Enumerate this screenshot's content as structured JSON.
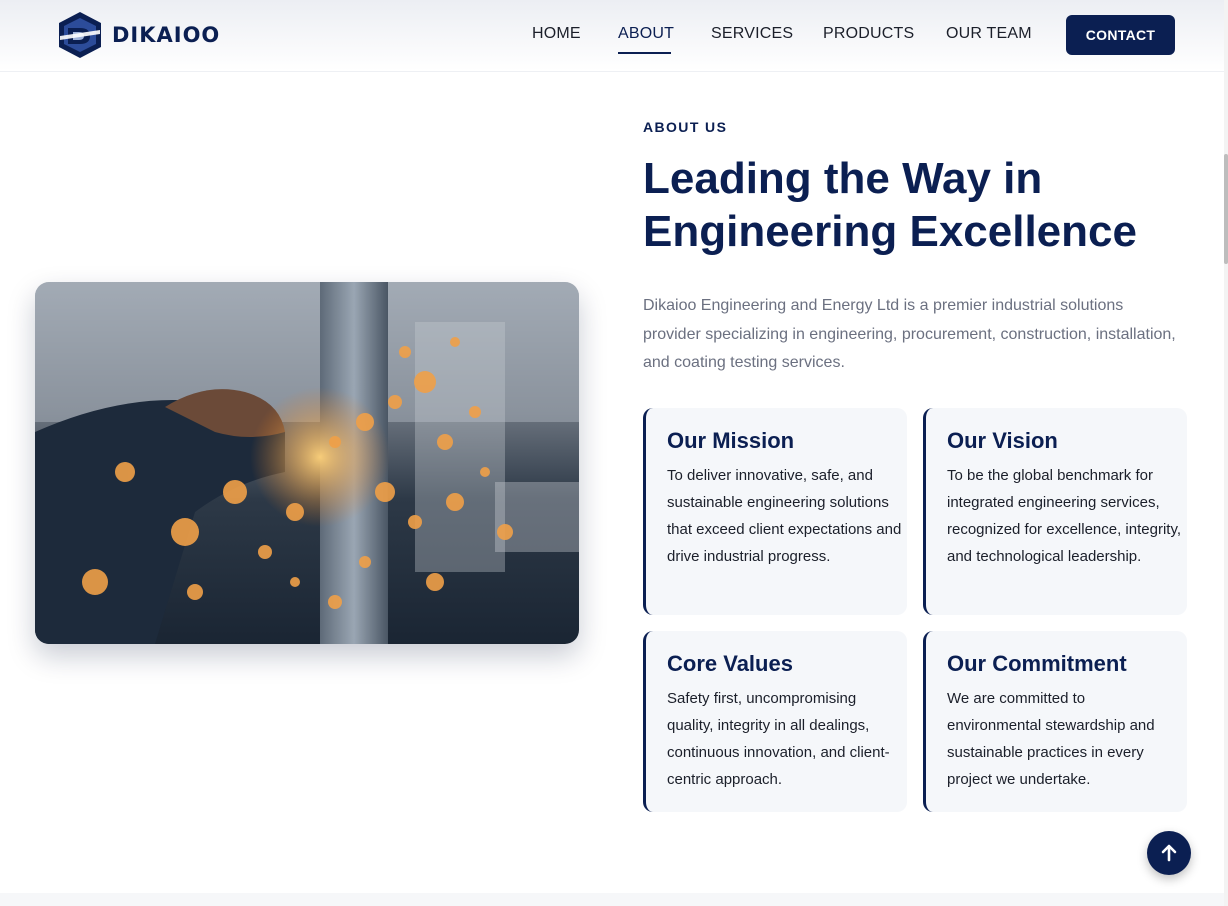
{
  "brand": {
    "name": "DIKAIOO"
  },
  "nav": {
    "items": [
      {
        "label": "HOME"
      },
      {
        "label": "ABOUT",
        "active": true
      },
      {
        "label": "SERVICES"
      },
      {
        "label": "PRODUCTS"
      },
      {
        "label": "OUR TEAM"
      }
    ],
    "contact_label": "CONTACT"
  },
  "about": {
    "eyebrow": "ABOUT US",
    "headline_line1": "Leading the Way in",
    "headline_line2": "Engineering Excellence",
    "intro": "Dikaioo Engineering and Energy Ltd is a premier industrial solutions provider specializing in engineering, procurement, construction, installation, and coating testing services.",
    "image_description": "welder-grinding-sparks-photo",
    "cards": [
      {
        "title": "Our Mission",
        "text": "To deliver innovative, safe, and sustainable engineering solutions that exceed client expectations and drive industrial progress."
      },
      {
        "title": "Our Vision",
        "text": "To be the global benchmark for integrated engineering services, recognized for excellence, integrity, and technological leadership."
      },
      {
        "title": "Core Values",
        "text": "Safety first, uncompromising quality, integrity in all dealings, continuous innovation, and client-centric approach."
      },
      {
        "title": "Our Commitment",
        "text": "We are committed to environmental stewardship and sustainable practices in every project we undertake."
      }
    ]
  },
  "icons": {
    "back_to_top": "arrow-up-icon",
    "logo": "dikaioo-logo-icon"
  },
  "colors": {
    "brand_navy": "#0b1f52",
    "body_text": "#6b7080",
    "card_bg": "#f5f7fa"
  }
}
